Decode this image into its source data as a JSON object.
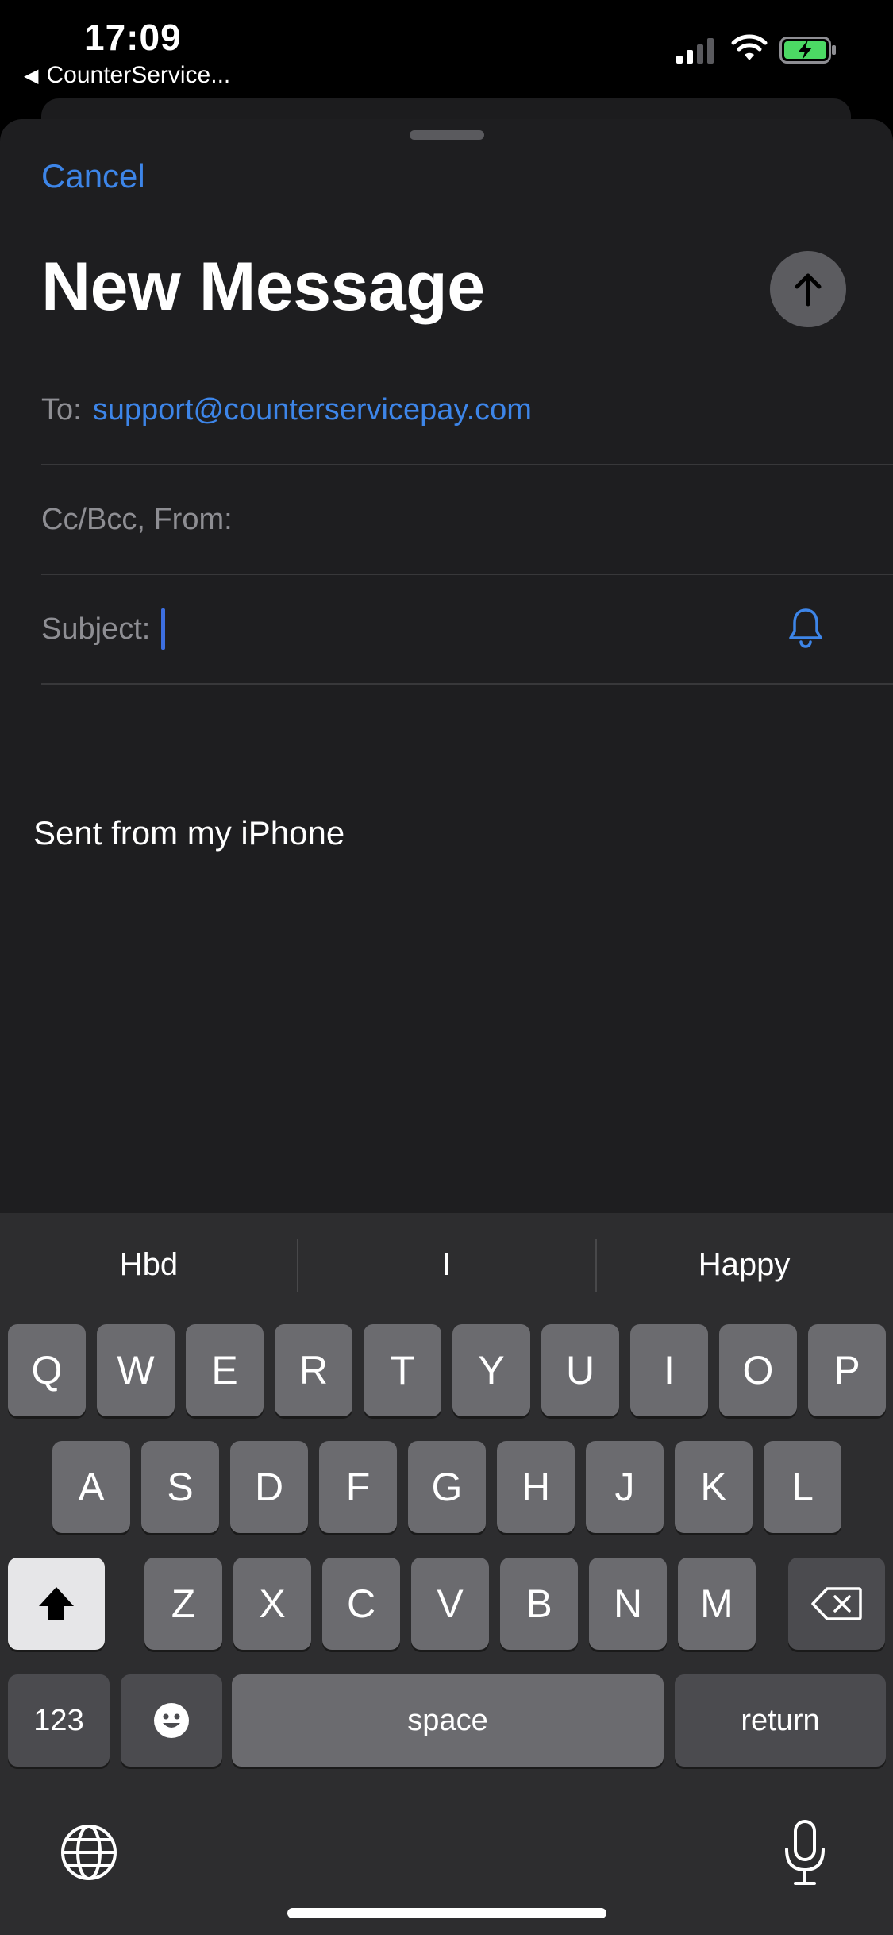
{
  "status_bar": {
    "time": "17:09",
    "back_app": "CounterService..."
  },
  "compose": {
    "cancel_label": "Cancel",
    "title": "New Message",
    "to_label": "To:",
    "to_value": "support@counterservicepay.com",
    "cc_label": "Cc/Bcc, From:",
    "subject_label": "Subject:",
    "subject_value": "",
    "body_signature": "Sent from my iPhone"
  },
  "keyboard": {
    "suggestions": [
      "Hbd",
      "I",
      "Happy"
    ],
    "row1": [
      "Q",
      "W",
      "E",
      "R",
      "T",
      "Y",
      "U",
      "I",
      "O",
      "P"
    ],
    "row2": [
      "A",
      "S",
      "D",
      "F",
      "G",
      "H",
      "J",
      "K",
      "L"
    ],
    "row3": [
      "Z",
      "X",
      "C",
      "V",
      "B",
      "N",
      "M"
    ],
    "numbers_label": "123",
    "space_label": "space",
    "return_label": "return"
  },
  "colors": {
    "accent": "#3d85e8",
    "sheet_bg": "#1e1e20",
    "keyboard_bg": "#2d2d2f",
    "battery_green": "#4cd964"
  }
}
